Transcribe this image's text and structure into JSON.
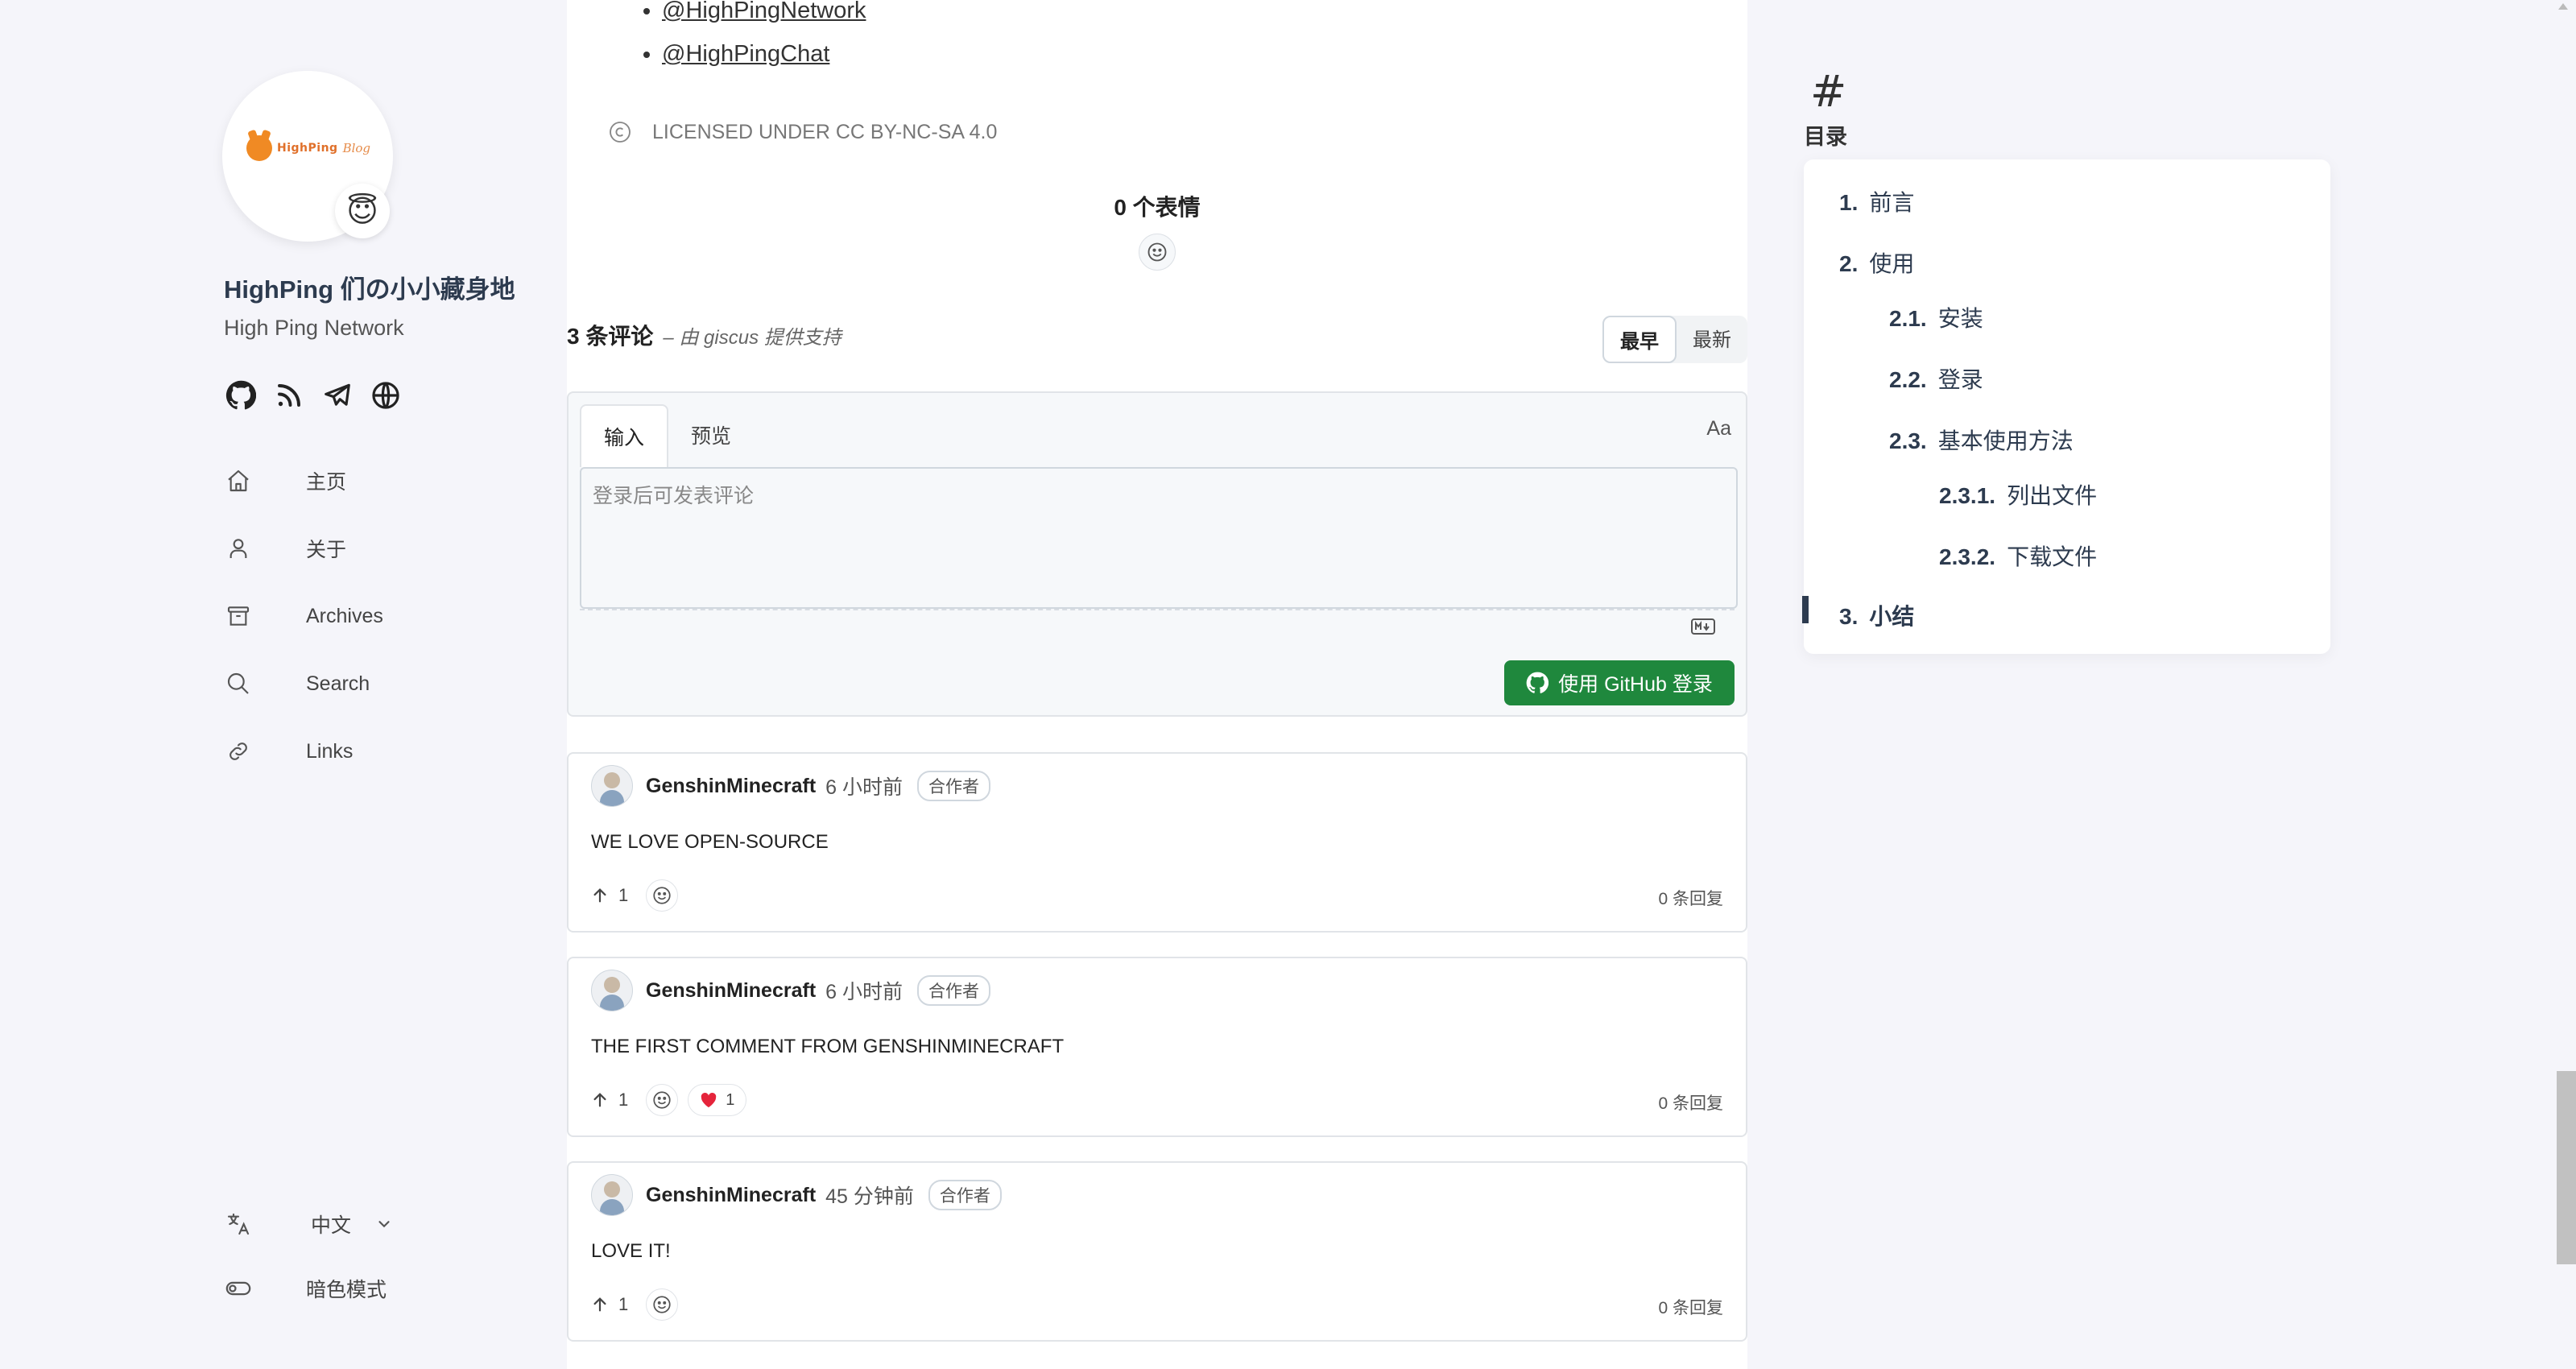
{
  "sidebar": {
    "logo_text": "HighPing",
    "logo_blog": "Blog",
    "emoji": "😇",
    "title": "HighPing 们の小小藏身地",
    "subtitle": "High Ping Network",
    "social_icons": [
      "github-icon",
      "rss-icon",
      "telegram-icon",
      "globe-icon"
    ],
    "menu": [
      {
        "icon": "home-icon",
        "label": "主页"
      },
      {
        "icon": "user-icon",
        "label": "关于"
      },
      {
        "icon": "archive-icon",
        "label": "Archives"
      },
      {
        "icon": "search-icon",
        "label": "Search"
      },
      {
        "icon": "link-icon",
        "label": "Links"
      }
    ],
    "language": {
      "icon": "translate-icon",
      "label": "中文"
    },
    "dark_mode": {
      "icon": "toggle-icon",
      "label": "暗色模式"
    }
  },
  "article": {
    "links": [
      "@HighPingNetwork",
      "@HighPingChat"
    ],
    "license": "LICENSED UNDER CC BY-NC-SA 4.0"
  },
  "giscus": {
    "reactions_count": "0 个表情",
    "comments_count": "3 条评论",
    "powered_by": "– 由 giscus 提供支持",
    "sort": {
      "oldest": "最早",
      "newest": "最新",
      "active": "最早"
    },
    "editor": {
      "tab_input": "输入",
      "tab_preview": "预览",
      "format_label": "Aa",
      "placeholder": "登录后可发表评论",
      "login_button": "使用 GitHub 登录"
    },
    "comments": [
      {
        "author": "GenshinMinecraft",
        "time": "6 小时前",
        "badge": "合作者",
        "body": "WE LOVE OPEN-SOURCE",
        "upvotes": "1",
        "heart": null,
        "replies": "0 条回复"
      },
      {
        "author": "GenshinMinecraft",
        "time": "6 小时前",
        "badge": "合作者",
        "body": "THE FIRST COMMENT FROM GENSHINMINECRAFT",
        "upvotes": "1",
        "heart": "1",
        "replies": "0 条回复"
      },
      {
        "author": "GenshinMinecraft",
        "time": "45 分钟前",
        "badge": "合作者",
        "body": "LOVE IT!",
        "upvotes": "1",
        "heart": null,
        "replies": "0 条回复"
      }
    ]
  },
  "toc": {
    "hash": "#",
    "title": "目录",
    "items": [
      {
        "num": "1.",
        "label": "前言"
      },
      {
        "num": "2.",
        "label": "使用"
      },
      {
        "num": "2.1.",
        "label": "安装"
      },
      {
        "num": "2.2.",
        "label": "登录"
      },
      {
        "num": "2.3.",
        "label": "基本使用方法"
      },
      {
        "num": "2.3.1.",
        "label": "列出文件"
      },
      {
        "num": "2.3.2.",
        "label": "下载文件"
      },
      {
        "num": "3.",
        "label": "小结",
        "active": true
      }
    ]
  }
}
